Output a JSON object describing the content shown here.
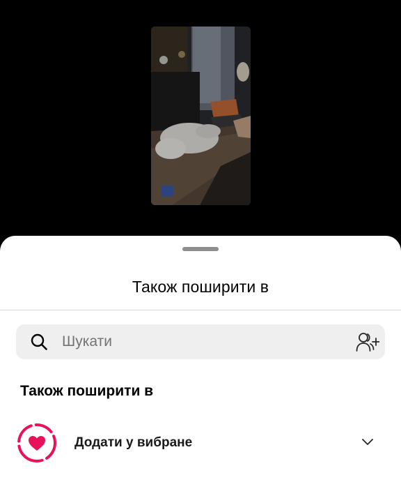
{
  "preview": {
    "icon": "video-thumbnail"
  },
  "sheet": {
    "title": "Також поширити в",
    "search": {
      "placeholder": "Шукати",
      "value": "",
      "leading_icon": "search-icon",
      "trailing_icon": "add-people-icon"
    },
    "section_heading": "Також поширити в",
    "items": [
      {
        "label": "Додати у вибране",
        "icon": "favorites-heart-icon",
        "trailing_icon": "chevron-down-icon"
      }
    ]
  },
  "colors": {
    "sheet_background": "#ffffff",
    "search_background": "#efefef",
    "favorites_accent": "#e8115b",
    "backdrop": "#000000"
  }
}
